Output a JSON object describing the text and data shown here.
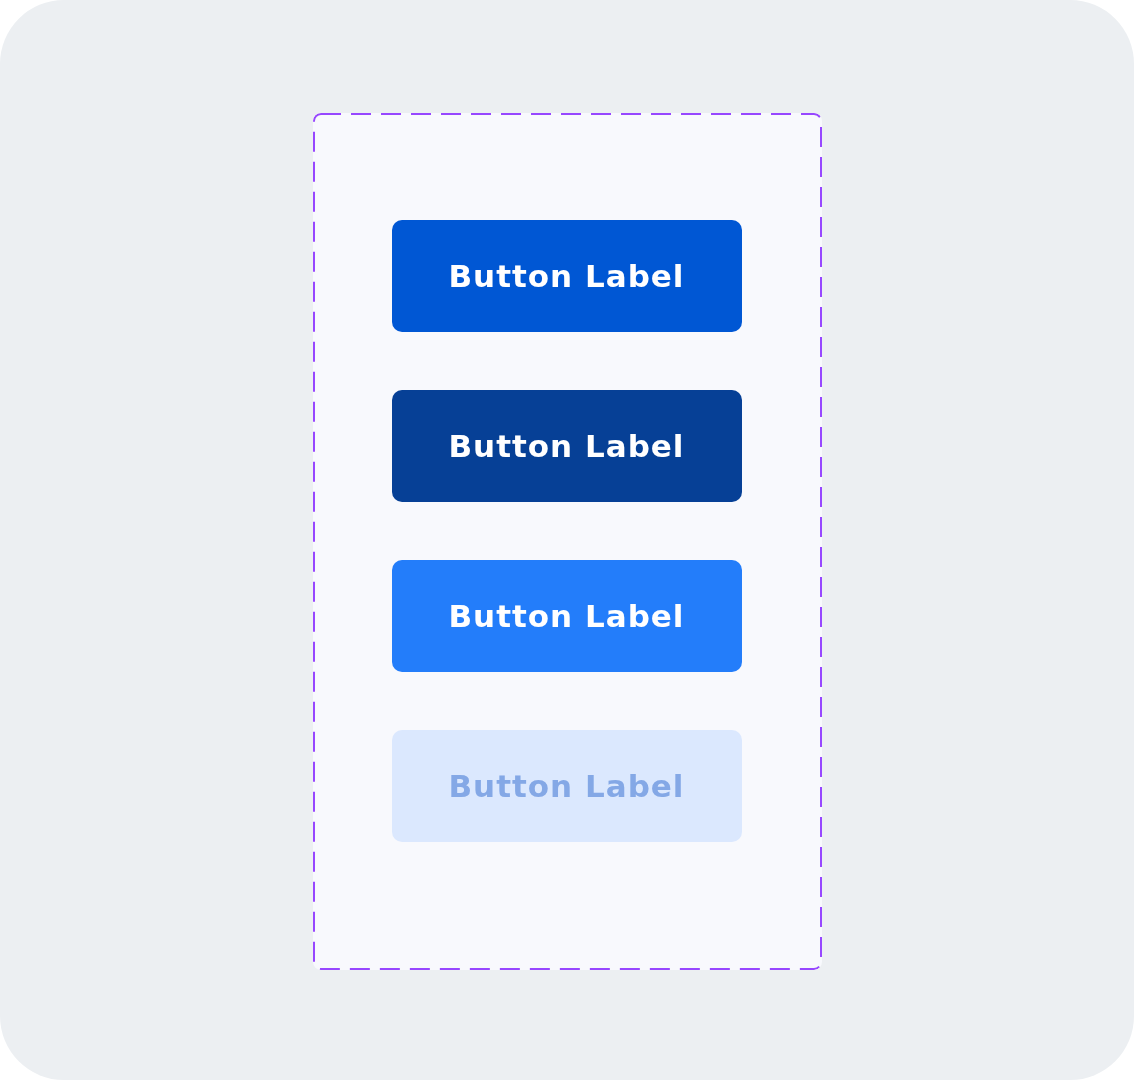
{
  "buttons": [
    {
      "label": "Button Label",
      "kind": "default"
    },
    {
      "label": "Button Label",
      "kind": "pressed"
    },
    {
      "label": "Button Label",
      "kind": "hover"
    },
    {
      "label": "Button Label",
      "kind": "disabled"
    }
  ]
}
